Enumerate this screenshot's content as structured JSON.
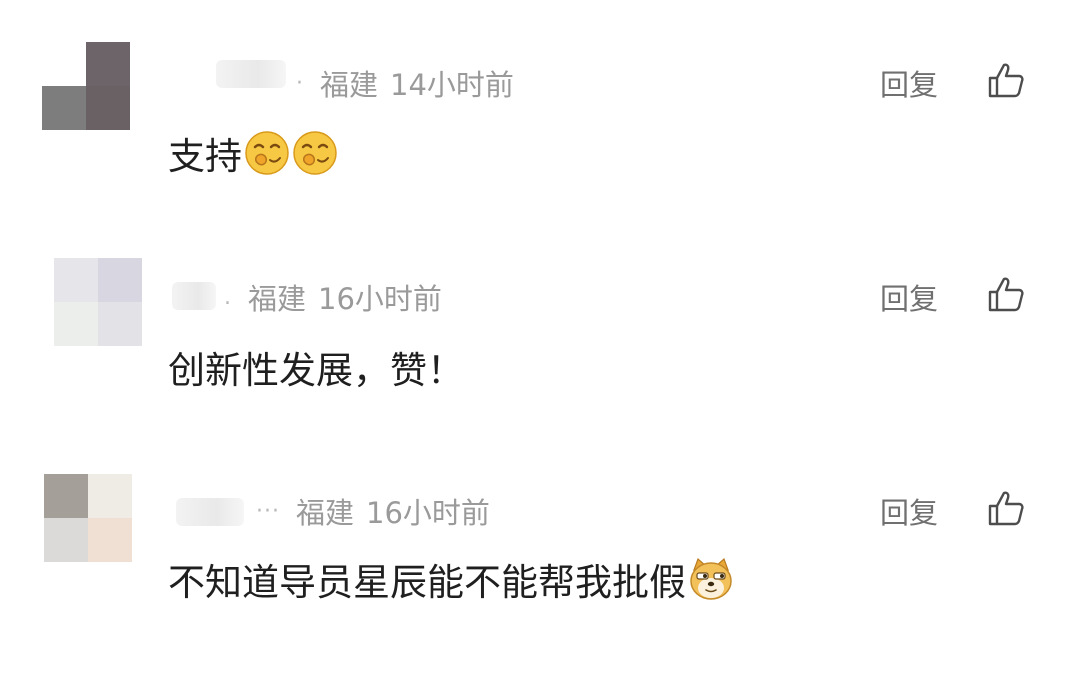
{
  "comments": [
    {
      "location": "福建",
      "time": "14小时前",
      "dots": "·",
      "reply_label": "回复",
      "text": "支持",
      "emojis": [
        "smirk-face-emoji",
        "smirk-face-emoji"
      ],
      "avatar_colors": [
        "#6c6469",
        "#6f6a6e",
        "#7d7d7d",
        "#6a6165"
      ]
    },
    {
      "location": "福建",
      "time": "16小时前",
      "dots": ".",
      "reply_label": "回复",
      "text": "创新性发展，赞！",
      "emojis": [],
      "avatar_colors": [
        "#e6e5ea",
        "#d8d6e0",
        "#eceeec",
        "#e3e2e6"
      ]
    },
    {
      "location": "福建",
      "time": "16小时前",
      "dots": "···",
      "reply_label": "回复",
      "text": "不知道导员星辰能不能帮我批假",
      "emojis": [
        "doge-emoji"
      ],
      "avatar_colors": [
        "#a59f9a",
        "#efece6",
        "#dcdad8",
        "#f0e0d4"
      ]
    }
  ],
  "icons": {
    "like": "thumbs-up-icon"
  }
}
